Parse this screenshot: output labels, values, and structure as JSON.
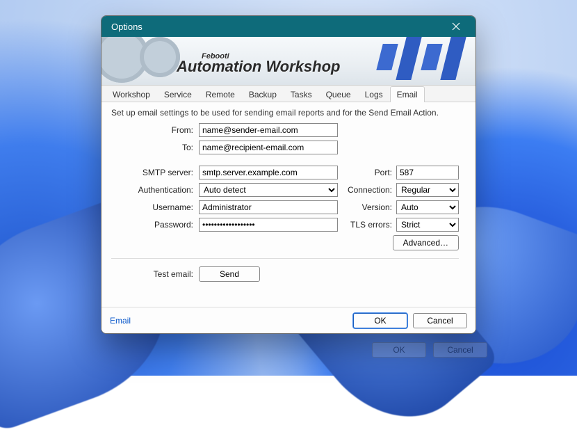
{
  "window": {
    "title": "Options"
  },
  "banner": {
    "small": "Febooti",
    "big": "Automation Workshop"
  },
  "tabs": [
    {
      "label": "Workshop",
      "active": false
    },
    {
      "label": "Service",
      "active": false
    },
    {
      "label": "Remote",
      "active": false
    },
    {
      "label": "Backup",
      "active": false
    },
    {
      "label": "Tasks",
      "active": false
    },
    {
      "label": "Queue",
      "active": false
    },
    {
      "label": "Logs",
      "active": false
    },
    {
      "label": "Email",
      "active": true
    }
  ],
  "description": "Set up email settings to be used for sending email reports and for the Send Email Action.",
  "labels": {
    "from": "From:",
    "to": "To:",
    "smtp": "SMTP server:",
    "auth": "Authentication:",
    "username": "Username:",
    "password": "Password:",
    "port": "Port:",
    "connection": "Connection:",
    "version": "Version:",
    "tls": "TLS errors:",
    "test": "Test email:"
  },
  "values": {
    "from": "name@sender-email.com",
    "to": "name@recipient-email.com",
    "smtp": "smtp.server.example.com",
    "auth": "Auto detect",
    "username": "Administrator",
    "password": "●●●●●●●●●●●●●●●●●●",
    "port": "587",
    "connection": "Regular",
    "version": "Auto",
    "tls": "Strict"
  },
  "buttons": {
    "advanced": "Advanced…",
    "send": "Send",
    "ok": "OK",
    "cancel": "Cancel"
  },
  "footer_link": "Email"
}
